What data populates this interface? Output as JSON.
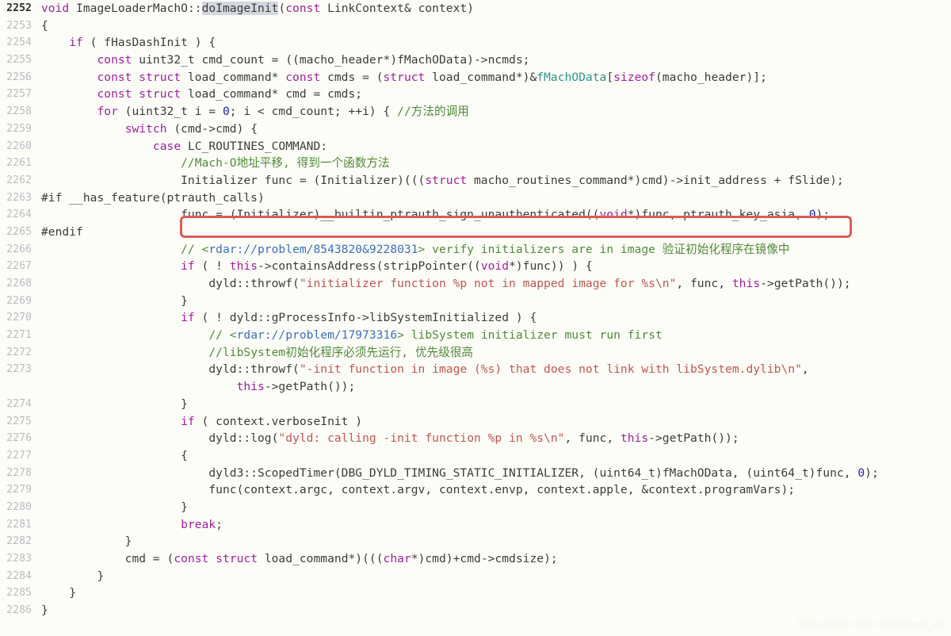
{
  "editor": {
    "language": "cpp",
    "background_color": "#fdfdf8",
    "current_line": "2252",
    "colors": {
      "keyword": "#a020a0",
      "string": "#c2564f",
      "comment": "#4f8a3a",
      "link": "#3a6fc4",
      "number": "#2222b0",
      "member": "#2e9389",
      "gutter": "#b9bcc0",
      "selection": "#d3d8de",
      "highlight_box": "#de5b55"
    },
    "selection_text": "doImageInit",
    "highlight_box_line": "2264"
  },
  "watermark": {
    "text": "https://blog.csdn.net/Forever_wj"
  },
  "lines": [
    {
      "n": "2252",
      "text": "void ImageLoaderMachO::doImageInit(const LinkContext& context)"
    },
    {
      "n": "2253",
      "text": "{"
    },
    {
      "n": "2254",
      "text": "    if ( fHasDashInit ) {"
    },
    {
      "n": "2255",
      "text": "        const uint32_t cmd_count = ((macho_header*)fMachOData)->ncmds;"
    },
    {
      "n": "2256",
      "text": "        const struct load_command* const cmds = (struct load_command*)&fMachOData[sizeof(macho_header)];"
    },
    {
      "n": "2257",
      "text": "        const struct load_command* cmd = cmds;"
    },
    {
      "n": "2258",
      "text": "        for (uint32_t i = 0; i < cmd_count; ++i) { //方法的调用"
    },
    {
      "n": "2259",
      "text": "            switch (cmd->cmd) {"
    },
    {
      "n": "2260",
      "text": "                case LC_ROUTINES_COMMAND:"
    },
    {
      "n": "2261",
      "text": "                    //Mach-O地址平移, 得到一个函数方法"
    },
    {
      "n": "2262",
      "text": "                    Initializer func = (Initializer)(((struct macho_routines_command*)cmd)->init_address + fSlide);"
    },
    {
      "n": "2263",
      "text": "#if __has_feature(ptrauth_calls)"
    },
    {
      "n": "2264",
      "text": "                    func = (Initializer)__builtin_ptrauth_sign_unauthenticated((void*)func, ptrauth_key_asia, 0);"
    },
    {
      "n": "2265",
      "text": "#endif"
    },
    {
      "n": "2266",
      "text": "                    // <rdar://problem/8543820&9228031> verify initializers are in image 验证初始化程序在镜像中"
    },
    {
      "n": "2267",
      "text": "                    if ( ! this->containsAddress(stripPointer((void*)func)) ) {"
    },
    {
      "n": "2268",
      "text": "                        dyld::throwf(\"initializer function %p not in mapped image for %s\\n\", func, this->getPath());"
    },
    {
      "n": "2269",
      "text": "                    }"
    },
    {
      "n": "2270",
      "text": "                    if ( ! dyld::gProcessInfo->libSystemInitialized ) {"
    },
    {
      "n": "2271",
      "text": "                        // <rdar://problem/17973316> libSystem initializer must run first"
    },
    {
      "n": "2272",
      "text": "                        //libSystem初始化程序必须先运行, 优先级很高"
    },
    {
      "n": "2273",
      "text": "                        dyld::throwf(\"-init function in image (%s) that does not link with libSystem.dylib\\n\","
    },
    {
      "n": "",
      "text": "                            this->getPath());"
    },
    {
      "n": "2274",
      "text": "                    }"
    },
    {
      "n": "2275",
      "text": "                    if ( context.verboseInit )"
    },
    {
      "n": "2276",
      "text": "                        dyld::log(\"dyld: calling -init function %p in %s\\n\", func, this->getPath());"
    },
    {
      "n": "2277",
      "text": "                    {"
    },
    {
      "n": "2278",
      "text": "                        dyld3::ScopedTimer(DBG_DYLD_TIMING_STATIC_INITIALIZER, (uint64_t)fMachOData, (uint64_t)func, 0);"
    },
    {
      "n": "2279",
      "text": "                        func(context.argc, context.argv, context.envp, context.apple, &context.programVars);"
    },
    {
      "n": "2280",
      "text": "                    }"
    },
    {
      "n": "2281",
      "text": "                    break;"
    },
    {
      "n": "2282",
      "text": "            }"
    },
    {
      "n": "2283",
      "text": "            cmd = (const struct load_command*)(((char*)cmd)+cmd->cmdsize);"
    },
    {
      "n": "2284",
      "text": "        }"
    },
    {
      "n": "2285",
      "text": "    }"
    },
    {
      "n": "2286",
      "text": "}"
    }
  ]
}
